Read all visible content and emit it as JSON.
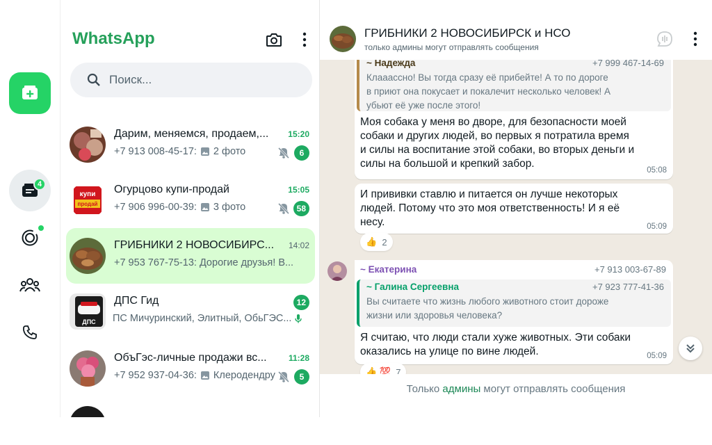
{
  "app": {
    "brand": "WhatsApp"
  },
  "rail": {
    "chats_badge": "4"
  },
  "search": {
    "placeholder": "Поиск..."
  },
  "chats": [
    {
      "name": "Дарим, меняемся, продаем,...",
      "time": "15:20",
      "sender": "+7 913 008-45-17:",
      "preview": "2 фото",
      "badge": "6",
      "muted": true,
      "photo": true
    },
    {
      "name": "Огурцово купи-продай",
      "time": "15:05",
      "sender": "+7 906 996-00-39:",
      "preview": "3 фото",
      "badge": "58",
      "muted": true,
      "photo": true
    },
    {
      "name": "ГРИБНИКИ 2 НОВОСИБИРС...",
      "time": "14:02",
      "sender": "+7 953 767-75-13:",
      "preview": "Дорогие друзья! В...",
      "badge": "",
      "muted": false,
      "photo": false
    },
    {
      "name": "ДПС Гид",
      "time": "",
      "sender": "ПС Мичуринский, Элитный, ОбьГЭС...",
      "preview": "",
      "badge": "12",
      "muted": false,
      "photo": false
    },
    {
      "name": "ОбъГэс-личные продажи вс...",
      "time": "11:28",
      "sender": "+7 952 937-04-36:",
      "preview": "Клеродендрум",
      "badge": "5",
      "muted": true,
      "photo": true
    }
  ],
  "avatar_labels": {
    "ogurcovo_line1": "купи",
    "ogurcovo_line2": "продай",
    "dps": "ДПС"
  },
  "conversation": {
    "title": "ГРИБНИКИ 2 НОВОСИБИРСК и НСО",
    "subtitle": "только админы могут отправлять сообщения",
    "messages": {
      "m1": {
        "quote_author": "~ Надежда",
        "quote_phone": "+7 999 467-14-69",
        "quote_line1": "Клааассно! Вы тогда сразу её прибейте! А то по дороге",
        "quote_line2": "в приют она покусает и покалечит несколько человек! А",
        "quote_line3": "убьют её уже после этого!",
        "line1": "Моя собака у меня во дворе, для безопасности моей",
        "line2": "собаки и других людей, во первых я потратила время",
        "line3": "и силы на воспитание этой собаки, во вторых деньги и",
        "line4": "силы на большой и крепкий забор.",
        "time": "05:08"
      },
      "m2": {
        "line1": "И прививки ставлю и питается он лучше некоторых",
        "line2": "людей. Потому что это моя ответственность! И я её",
        "line3": "несу.",
        "time": "05:09",
        "reaction": "👍",
        "reaction_count": "2"
      },
      "m3": {
        "sender": "~ Екатерина",
        "sender_phone": "+7 913 003-67-89",
        "quote_author": "~ Галина Сергеевна",
        "quote_phone": "+7 923 777-41-36",
        "quote_line1": "Вы считаете что жизнь любого животного стоит дороже",
        "quote_line2": "жизни или здоровья человека?",
        "line1": "Я считаю, что люди стали хуже животных. Эти собаки",
        "line2": "оказались на улице по вине людей.",
        "time": "05:09",
        "reaction": "👍 💯",
        "reaction_count": "7"
      }
    },
    "footer_before": "Только ",
    "footer_link": "админы",
    "footer_after": " могут отправлять сообщения"
  },
  "colors": {
    "accent": "#25d366",
    "brand": "#25a05a",
    "selected_chat": "#d9fdd3",
    "wallpaper": "#efeae2"
  },
  "icons": [
    "new-chat-icon",
    "chats-icon",
    "status-icon",
    "communities-icon",
    "calls-icon",
    "camera-icon",
    "more-icon",
    "search-icon",
    "mute-icon",
    "photo-icon",
    "voice-icon",
    "scroll-down-icon"
  ]
}
